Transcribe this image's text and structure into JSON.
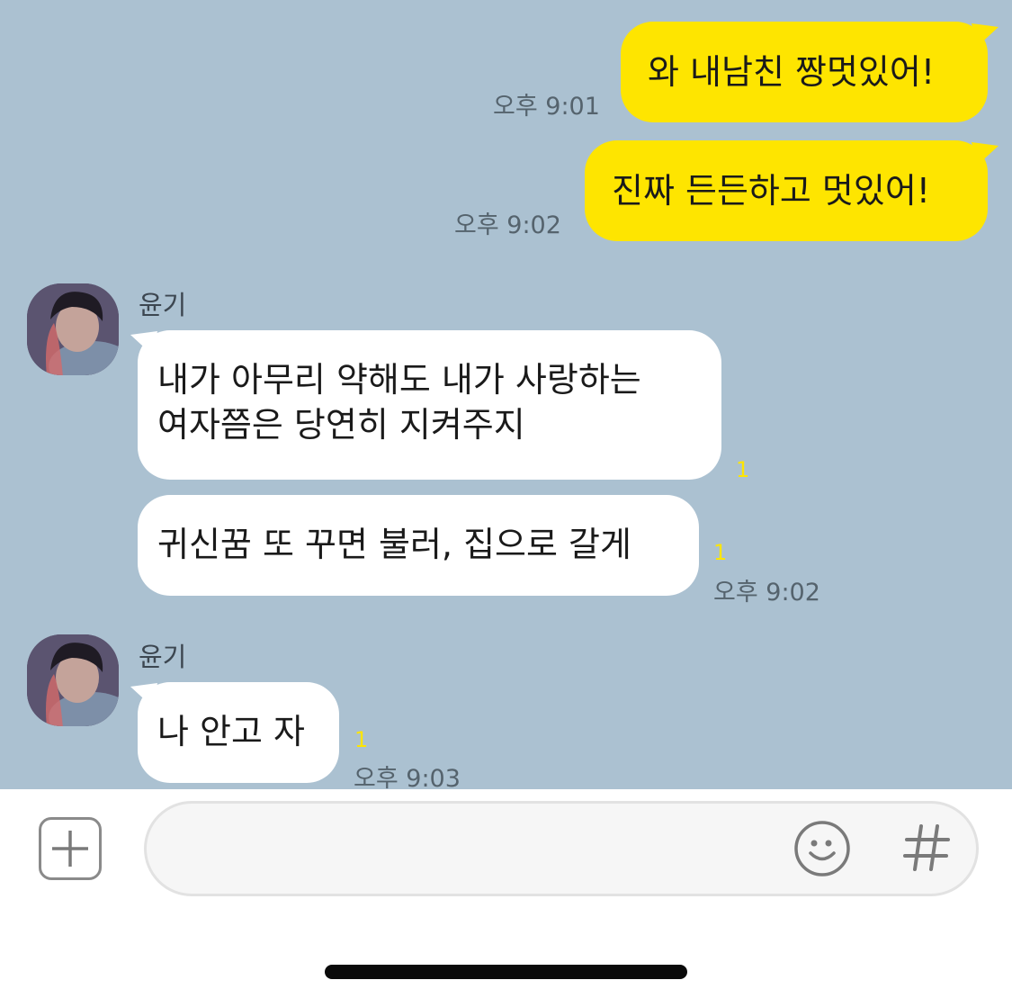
{
  "messages": [
    {
      "sender": "me",
      "text": "와 내남친 짱멋있어!",
      "time": "오후 9:01"
    },
    {
      "sender": "me",
      "text": "진짜 든든하고 멋있어!",
      "time": "오후 9:02"
    },
    {
      "sender": "윤기",
      "lines": [
        "내가 아무리 약해도 내가 사랑하는",
        "여자쯤은 당연히 지켜주지"
      ],
      "unread": "1"
    },
    {
      "sender": "윤기",
      "text": "귀신꿈 또 꾸면 불러, 집으로 갈게",
      "unread": "1",
      "time": "오후 9:02"
    },
    {
      "sender": "윤기",
      "text": "나 안고 자",
      "unread": "1",
      "time": "오후 9:03"
    }
  ],
  "contact": {
    "name": "윤기"
  },
  "input": {
    "placeholder": "",
    "value": ""
  },
  "icons": {
    "attach": "plus-icon",
    "emoji": "smiley-icon",
    "hashtag": "hashtag-icon"
  },
  "colors": {
    "chat_background": "#abc1d1",
    "my_bubble": "#fee500",
    "their_bubble": "#ffffff",
    "unread": "#fee500"
  }
}
